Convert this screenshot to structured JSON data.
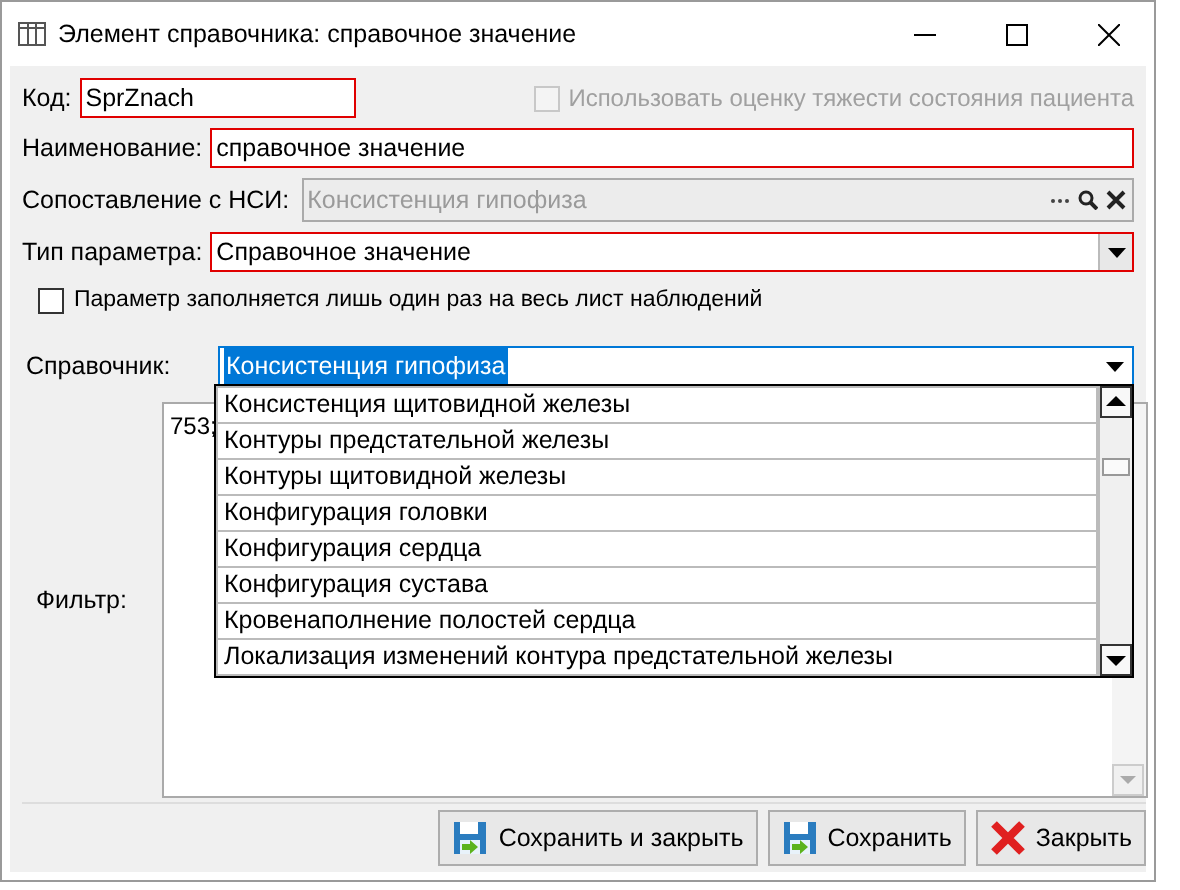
{
  "window": {
    "title": "Элемент справочника: справочное значение"
  },
  "fields": [
    {
      "kind": "text",
      "label": "Код:",
      "value": "SprZnach",
      "required": true
    },
    {
      "kind": "text",
      "label": "Наименование:",
      "value": "справочное значение",
      "required": true
    },
    {
      "kind": "lookup",
      "label": "Сопоставление с НСИ:",
      "value": "Консистенция гипофиза",
      "disabled": true
    },
    {
      "kind": "select",
      "label": "Тип параметра:",
      "value": "Справочное значение",
      "required": true
    }
  ],
  "severity_checkbox": {
    "label": "Использовать оценку тяжести состояния пациента",
    "checked": false,
    "disabled": true
  },
  "once_checkbox": {
    "label": "Параметр заполняется лишь один раз на весь лист наблюдений",
    "checked": false
  },
  "reference": {
    "label": "Справочник:",
    "value": "Консистенция гипофиза",
    "expanded": true,
    "options": [
      {
        "label": "Консистенция щитовидной железы"
      },
      {
        "label": "Контуры предстательной железы"
      },
      {
        "label": "Контуры щитовидной железы"
      },
      {
        "label": "Конфигурация головки"
      },
      {
        "label": "Конфигурация сердца"
      },
      {
        "label": "Конфигурация сустава"
      },
      {
        "label": "Кровенаполнение полостей сердца"
      },
      {
        "label": "Локализация изменений контура предстательной железы"
      }
    ]
  },
  "filter": {
    "label": "Фильтр:",
    "value": "753;"
  },
  "buttons": [
    {
      "kind": "save",
      "label": "Сохранить и закрыть"
    },
    {
      "kind": "save",
      "label": "Сохранить"
    },
    {
      "kind": "close",
      "label": "Закрыть"
    }
  ]
}
